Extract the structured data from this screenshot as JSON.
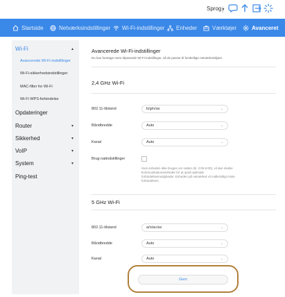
{
  "topbar": {
    "language": "Sprog",
    "icons": [
      "chat-icon",
      "upload-icon",
      "exit-icon",
      "loading-icon"
    ]
  },
  "nav": {
    "items": [
      {
        "label": "Startside",
        "icon": "home-icon"
      },
      {
        "label": "Netværksindstillinger",
        "icon": "globe-icon"
      },
      {
        "label": "Wi-Fi-indstillinger",
        "icon": "wifi-icon"
      },
      {
        "label": "Enheder",
        "icon": "devices-icon"
      },
      {
        "label": "Værktøjer",
        "icon": "toolbox-icon"
      },
      {
        "label": "Avanceret",
        "icon": "gear-icon",
        "active": true
      }
    ]
  },
  "sidebar": {
    "wifi": "Wi-Fi",
    "wifi_sub": [
      "Avancerede Wi-Fi-indstillinger",
      "Wi-Fi-sikkerhedsindstillinger",
      "MAC-filter for Wi-Fi",
      "Wi-Fi WPS-forbindelse"
    ],
    "items": [
      "Opdateringer",
      "Router",
      "Sikkerhed",
      "VoIP",
      "System",
      "Ping-test"
    ]
  },
  "main": {
    "title": "Avancerede Wi-Fi-indstillinger",
    "description": "Du kan foretage mere tilpassede Wi-Fi-indstillinger, så de passer til forskellige netværksmiljøer.",
    "section_24": "2,4 GHz Wi-Fi",
    "section_5": "5 GHz Wi-Fi",
    "labels": {
      "standard": "802.11-tilstand",
      "bandwidth": "Båndbredde",
      "channel": "Kanal",
      "night": "Brug natindstillinger"
    },
    "values_24": {
      "standard": "b/g/n/ax",
      "bandwidth": "Auto",
      "channel": "Auto"
    },
    "values_5": {
      "standard": "a/n/ac/ax",
      "bandwidth": "Auto",
      "channel": "Auto"
    },
    "night_hint": "Hvis enheden ikke bruges om natten (kl. 2:00-6:00), vil den slukke kommunikationsenheder for at opnå optimale forbindelsesmuligheder. Enheden på netværket vil midlertidigt miste forbindelsen.",
    "save": "Gem"
  },
  "colors": {
    "accent": "#3a88e8",
    "highlight": "#b07f3a"
  }
}
